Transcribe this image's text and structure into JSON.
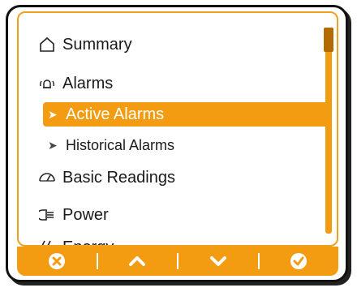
{
  "menu": {
    "items": [
      {
        "label": "Summary",
        "icon": "home-icon",
        "level": 1
      },
      {
        "label": "Alarms",
        "icon": "alarm-icon",
        "level": 1
      },
      {
        "label": "Active Alarms",
        "icon": "chevron-right-icon",
        "level": 2,
        "selected": true
      },
      {
        "label": "Historical Alarms",
        "icon": "chevron-right-icon",
        "level": 2
      },
      {
        "label": "Basic Readings",
        "icon": "gauge-icon",
        "level": 1
      },
      {
        "label": "Power",
        "icon": "power-plug-icon",
        "level": 1
      },
      {
        "label": "Energy",
        "icon": "energy-icon",
        "level": 1
      }
    ]
  },
  "toolbar": {
    "buttons": [
      {
        "action": "cancel",
        "icon": "cancel-circle-icon"
      },
      {
        "action": "up",
        "icon": "chevron-up-icon"
      },
      {
        "action": "down",
        "icon": "chevron-down-icon"
      },
      {
        "action": "confirm",
        "icon": "check-circle-icon"
      }
    ]
  },
  "colors": {
    "accent": "#f39c12",
    "scroll_thumb": "#b36b00",
    "text": "#1a1a1a"
  }
}
